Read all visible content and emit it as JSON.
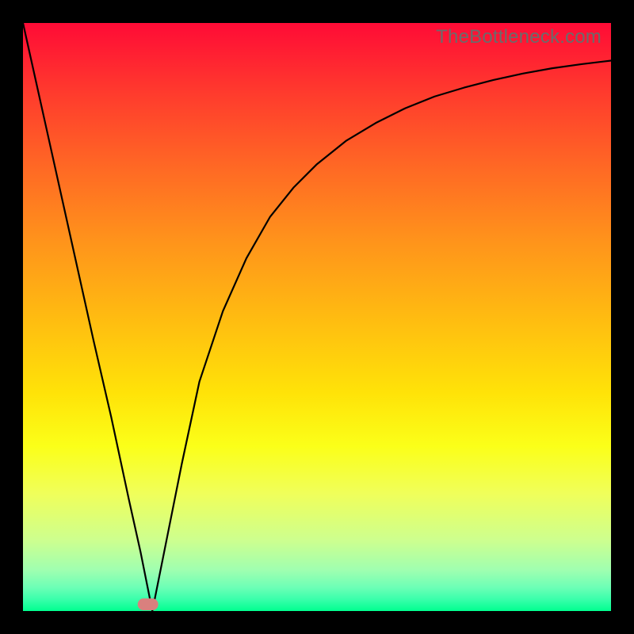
{
  "watermark": "TheBottleneck.com",
  "chart_data": {
    "type": "line",
    "title": "",
    "xlabel": "",
    "ylabel": "",
    "xlim": [
      0,
      100
    ],
    "ylim": [
      0,
      100
    ],
    "x": [
      0,
      4,
      8,
      12,
      15,
      18,
      20,
      21,
      22,
      24,
      27,
      30,
      34,
      38,
      42,
      46,
      50,
      55,
      60,
      65,
      70,
      75,
      80,
      85,
      90,
      95,
      100
    ],
    "values": [
      100,
      82,
      64,
      46,
      33,
      19,
      10,
      5,
      0,
      10,
      25,
      39,
      51,
      60,
      67,
      72,
      76,
      80,
      83,
      85.5,
      87.5,
      89,
      90.3,
      91.4,
      92.3,
      93,
      93.6
    ],
    "marker": {
      "x": 21,
      "width": 3,
      "height": 2,
      "color": "#d9807e"
    },
    "gradient_stops": [
      {
        "pos": 0,
        "color": "#ff0b36"
      },
      {
        "pos": 100,
        "color": "#00ff90"
      }
    ]
  }
}
